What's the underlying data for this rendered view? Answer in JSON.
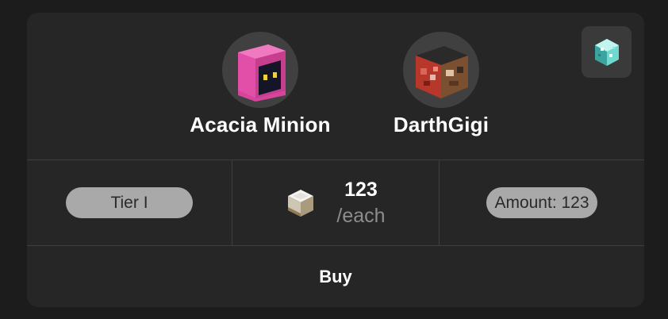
{
  "players": [
    {
      "name": "Acacia Minion",
      "icon": "pink-hood-minion-head-icon"
    },
    {
      "name": "DarthGigi",
      "icon": "red-skin-player-head-icon"
    }
  ],
  "corner_badge": {
    "icon": "diamond-gem-icon"
  },
  "listing": {
    "tier": "Tier I",
    "price": "123",
    "price_unit": "/each",
    "price_icon": "stone-block-icon",
    "amount": "Amount: 123"
  },
  "actions": {
    "buy_label": "Buy"
  },
  "colors": {
    "background": "#1c1c1c",
    "card": "#262626",
    "pill": "#a9a9a9",
    "divider": "#3e3e3e"
  }
}
